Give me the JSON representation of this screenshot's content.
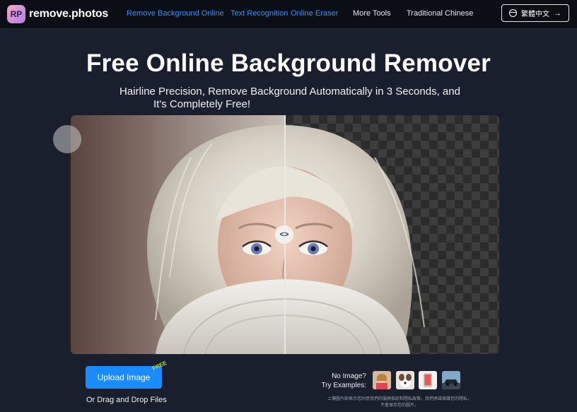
{
  "header": {
    "logo_text": "remove.photos",
    "logo_mark": "RP",
    "nav": [
      {
        "label": "Remove Background Online",
        "active": true
      },
      {
        "label": "Text Recognition",
        "active": true
      },
      {
        "label": "Online Eraser",
        "active": true
      },
      {
        "label": "More Tools",
        "active": false
      },
      {
        "label": "Traditional Chinese",
        "active": false
      }
    ],
    "lang_button": {
      "label": "繁體中文",
      "icon": "globe-icon",
      "arrow": "→"
    }
  },
  "hero": {
    "title": "Free Online Background Remover",
    "subtitle_line1": "Hairline Precision, Remove Background Automatically in 3 Seconds, and",
    "subtitle_line2": "It's Completely Free!"
  },
  "compare": {
    "handle_icon": "<>"
  },
  "actions": {
    "upload_label": "Upload Image",
    "free_badge": "FREE",
    "drag_text": "Or Drag and Drop Files"
  },
  "examples": {
    "line1": "No Image?",
    "line2": "Try Examples:",
    "thumbs": [
      "person-thumb",
      "dog-thumb",
      "phone-thumb",
      "car-thumb"
    ]
  },
  "disclaimer": {
    "line1": "上傳圖片即表示您同意我們的服務條款和隱私政策，我們承諾保護您的隱私，",
    "line2": "不會保存您的圖片。"
  },
  "colors": {
    "accent": "#1a8cff",
    "nav_active": "#3b8ef0",
    "background": "#1a1f2e",
    "header": "#0b0e15"
  }
}
